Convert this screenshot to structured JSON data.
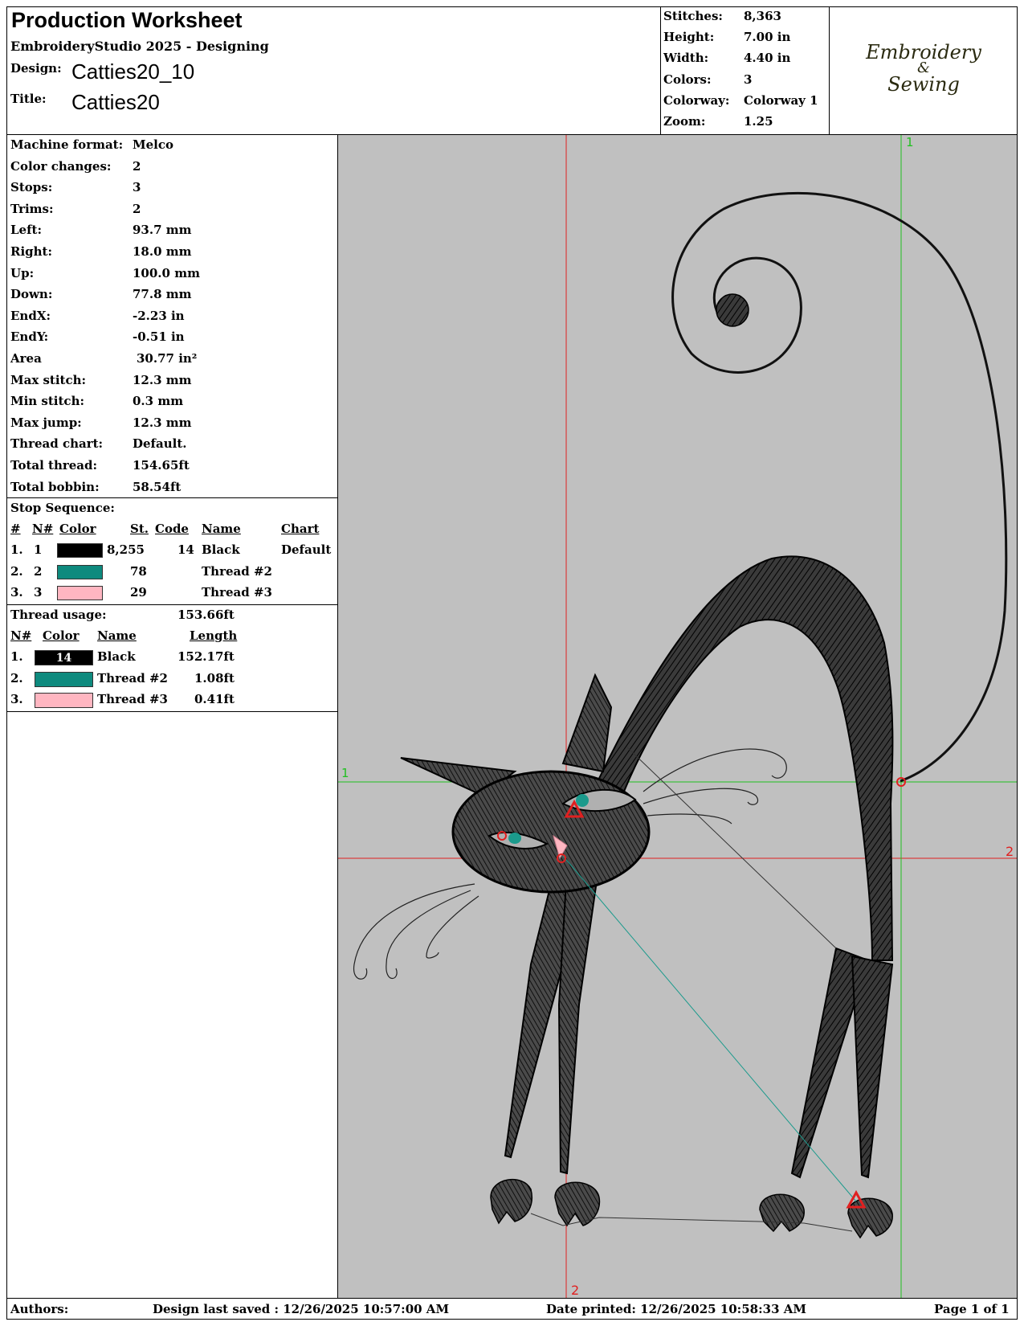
{
  "header": {
    "title": "Production Worksheet",
    "software": "EmbroideryStudio 2025 - Designing",
    "design_label": "Design:",
    "design_value": "Catties20_10",
    "title_label": "Title:",
    "title_value": "Catties20"
  },
  "summary": [
    {
      "label": "Stitches:",
      "value": "8,363"
    },
    {
      "label": "Height:",
      "value": "7.00 in"
    },
    {
      "label": "Width:",
      "value": "4.40 in"
    },
    {
      "label": "Colors:",
      "value": "3"
    },
    {
      "label": "Colorway:",
      "value": "Colorway 1"
    },
    {
      "label": "Zoom:",
      "value": "1.25"
    }
  ],
  "logo": {
    "line1": "Embroidery",
    "line2": "&",
    "line3": "Sewing"
  },
  "details": [
    {
      "label": "Machine format:",
      "value": "Melco"
    },
    {
      "label": "Color changes:",
      "value": "2"
    },
    {
      "label": "Stops:",
      "value": "3"
    },
    {
      "label": "Trims:",
      "value": "2"
    },
    {
      "label": "Left:",
      "value": "93.7 mm"
    },
    {
      "label": "Right:",
      "value": "18.0 mm"
    },
    {
      "label": "Up:",
      "value": "100.0 mm"
    },
    {
      "label": "Down:",
      "value": "77.8 mm"
    },
    {
      "label": "EndX:",
      "value": "-2.23 in"
    },
    {
      "label": "EndY:",
      "value": "-0.51 in"
    },
    {
      "label": "Area",
      "value": "30.77 in²"
    },
    {
      "label": "Max stitch:",
      "value": "12.3 mm"
    },
    {
      "label": "Min stitch:",
      "value": "0.3 mm"
    },
    {
      "label": "Max jump:",
      "value": "12.3 mm"
    },
    {
      "label": "Thread chart:",
      "value": "Default."
    },
    {
      "label": "Total thread:",
      "value": "154.65ft"
    },
    {
      "label": "Total bobbin:",
      "value": "58.54ft"
    }
  ],
  "stop_sequence": {
    "heading": "Stop Sequence:",
    "columns": [
      "#",
      "N#",
      "Color",
      "St.",
      "Code",
      "Name",
      "Chart"
    ],
    "rows": [
      {
        "num": "1.",
        "n": "1",
        "color": "#000000",
        "st": "8,255",
        "code": "14",
        "name": "Black",
        "chart": "Default"
      },
      {
        "num": "2.",
        "n": "2",
        "color": "#0e8a7e",
        "st": "78",
        "code": "",
        "name": "Thread #2",
        "chart": ""
      },
      {
        "num": "3.",
        "n": "3",
        "color": "#ffb6c1",
        "st": "29",
        "code": "",
        "name": "Thread #3",
        "chart": ""
      }
    ]
  },
  "thread_usage": {
    "heading": "Thread usage:",
    "total": "153.66ft",
    "columns": [
      "N#",
      "Color",
      "Name",
      "Length"
    ],
    "rows": [
      {
        "num": "1.",
        "color": "#000000",
        "code": "14",
        "name": "Black",
        "length": "152.17ft"
      },
      {
        "num": "2.",
        "color": "#0e8a7e",
        "code": "",
        "name": "Thread #2",
        "length": "1.08ft"
      },
      {
        "num": "3.",
        "color": "#ffb6c1",
        "code": "",
        "name": "Thread #3",
        "length": "0.41ft"
      }
    ]
  },
  "canvas": {
    "background": "#c0c0c0",
    "marker_1_top": "1",
    "marker_1_left": "1",
    "marker_2_right": "2",
    "marker_2_bottom": "2"
  },
  "footer": {
    "authors": "Authors:",
    "saved": "Design last saved : 12/26/2025 10:57:00 AM",
    "printed": "Date printed: 12/26/2025 10:58:33 AM",
    "page": "Page 1 of 1"
  }
}
